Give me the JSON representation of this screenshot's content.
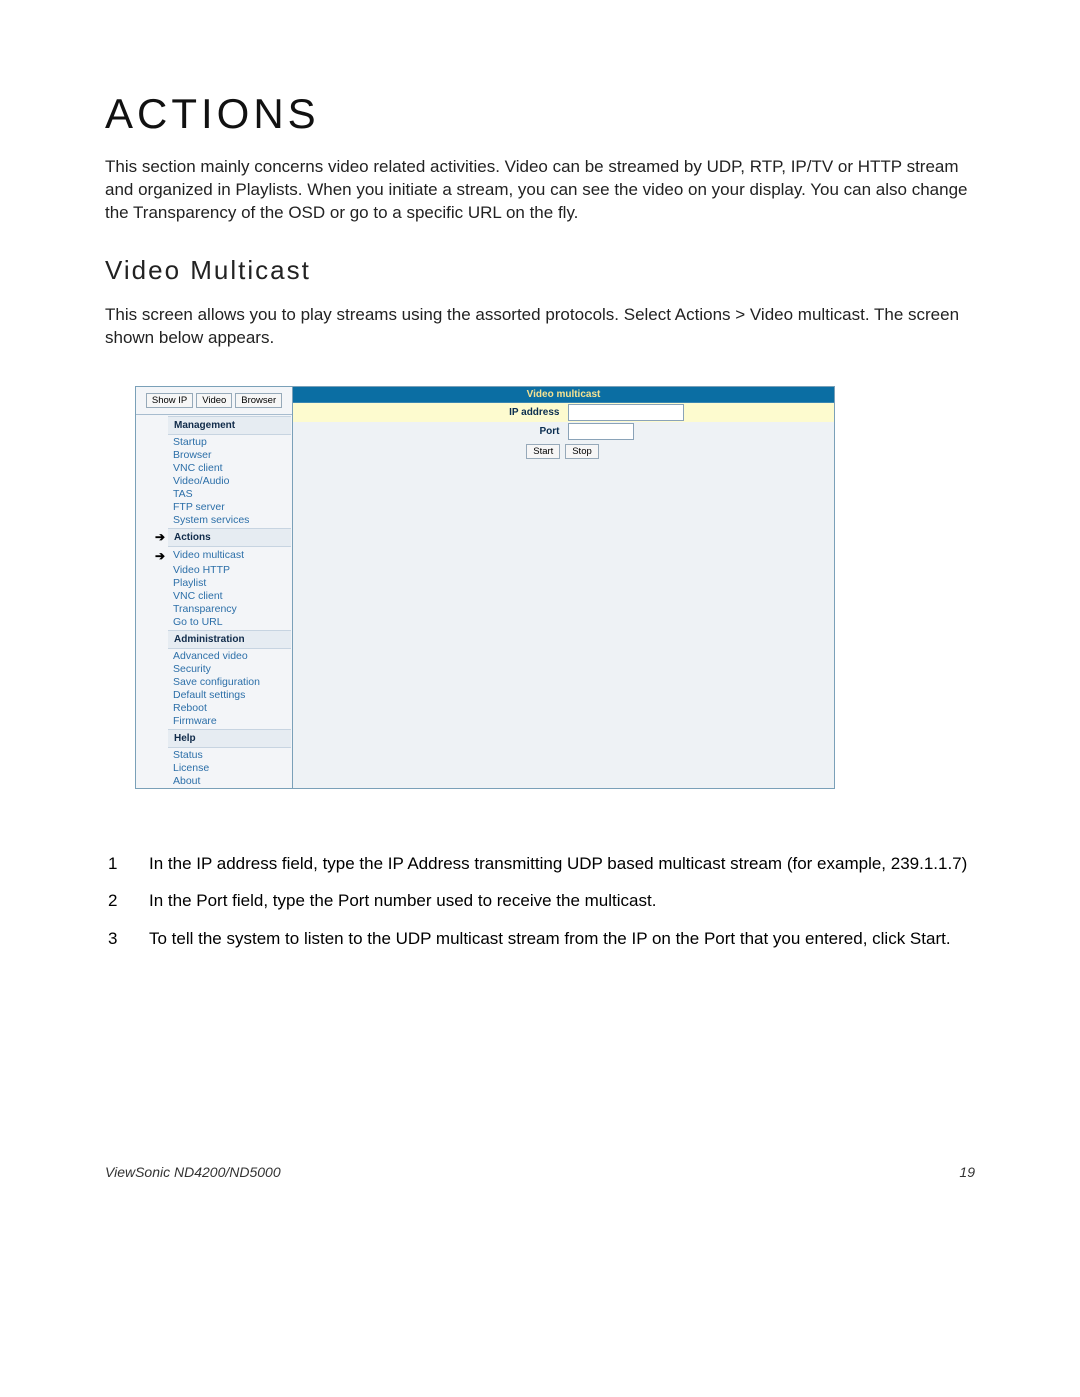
{
  "heading": "ACTIONS",
  "intro": "This section mainly concerns video related activities. Video can be streamed by UDP, RTP, IP/TV or HTTP stream and organized in Playlists. When you initiate a stream, you can see the video on your display. You can also change the Transparency of the OSD or go to a specific URL on the fly.",
  "sub_heading": "Video Multicast",
  "sub_intro": "This screen allows you to play streams using the assorted protocols. Select Actions > Video multicast. The screen shown below appears.",
  "sidebar": {
    "top_buttons": [
      "Show IP",
      "Video",
      "Browser"
    ],
    "sections": [
      {
        "title": "Management",
        "items": [
          "Startup",
          "Browser",
          "VNC client",
          "Video/Audio",
          "TAS",
          "FTP server",
          "System services"
        ]
      },
      {
        "title": "Actions",
        "items": [
          "Video multicast",
          "Video HTTP",
          "Playlist",
          "VNC client",
          "Transparency",
          "Go to URL"
        ]
      },
      {
        "title": "Administration",
        "items": [
          "Advanced video",
          "Security",
          "Save configuration",
          "Default settings",
          "Reboot",
          "Firmware"
        ]
      },
      {
        "title": "Help",
        "items": [
          "Status",
          "License",
          "About"
        ]
      }
    ]
  },
  "panel": {
    "title": "Video multicast",
    "fields": {
      "ip_label": "IP address",
      "ip_value": "",
      "port_label": "Port",
      "port_value": ""
    },
    "buttons": {
      "start": "Start",
      "stop": "Stop"
    }
  },
  "steps": [
    {
      "n": "1",
      "text": "In the IP address field, type the IP Address transmitting UDP based multicast stream (for example, 239.1.1.7)"
    },
    {
      "n": "2",
      "text": "In the Port field, type the Port number used to receive the multicast."
    },
    {
      "n": "3",
      "text": "To tell the system to listen to the UDP multicast stream from the IP on the Port that you entered, click Start."
    }
  ],
  "footer": {
    "left": "ViewSonic ND4200/ND5000",
    "right": "19"
  }
}
